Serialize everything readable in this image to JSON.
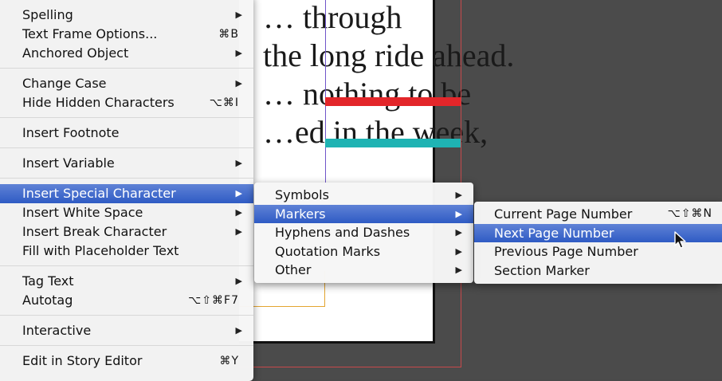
{
  "background": {
    "story_lines": [
      "… through",
      "the long ride ahead.",
      "… nothing to be",
      "…ed in the week,"
    ]
  },
  "main_menu": {
    "groups": [
      [
        {
          "label": "Spelling",
          "submenu": true
        },
        {
          "label": "Text Frame Options...",
          "shortcut": "⌘B"
        },
        {
          "label": "Anchored Object",
          "submenu": true
        }
      ],
      [
        {
          "label": "Change Case",
          "submenu": true
        },
        {
          "label": "Hide Hidden Characters",
          "shortcut": "⌥⌘I"
        }
      ],
      [
        {
          "label": "Insert Footnote"
        }
      ],
      [
        {
          "label": "Insert Variable",
          "submenu": true
        }
      ],
      [
        {
          "label": "Insert Special Character",
          "submenu": true,
          "active": true
        },
        {
          "label": "Insert White Space",
          "submenu": true
        },
        {
          "label": "Insert Break Character",
          "submenu": true
        },
        {
          "label": "Fill with Placeholder Text"
        }
      ],
      [
        {
          "label": "Tag Text",
          "submenu": true
        },
        {
          "label": "Autotag",
          "shortcut": "⌥⇧⌘F7"
        }
      ],
      [
        {
          "label": "Interactive",
          "submenu": true
        }
      ],
      [
        {
          "label": "Edit in Story Editor",
          "shortcut": "⌘Y"
        }
      ]
    ]
  },
  "special_character_menu": {
    "items": [
      {
        "label": "Symbols",
        "submenu": true
      },
      {
        "label": "Markers",
        "submenu": true,
        "active": true
      },
      {
        "label": "Hyphens and Dashes",
        "submenu": true
      },
      {
        "label": "Quotation Marks",
        "submenu": true
      },
      {
        "label": "Other",
        "submenu": true
      }
    ]
  },
  "markers_menu": {
    "items": [
      {
        "label": "Current Page Number",
        "shortcut": "⌥⇧⌘N"
      },
      {
        "label": "Next Page Number",
        "active": true
      },
      {
        "label": "Previous Page Number"
      },
      {
        "label": "Section Marker"
      }
    ]
  },
  "colors": {
    "highlight": "#3a63c9",
    "menu_bg": "#f6f6f6",
    "pasteboard": "#4b4b4b",
    "red_bar": "#e3262a",
    "teal_bar": "#1fb3b3"
  },
  "icons": {
    "submenu_arrow": "▶",
    "pointer": "arrow-cursor-icon"
  }
}
